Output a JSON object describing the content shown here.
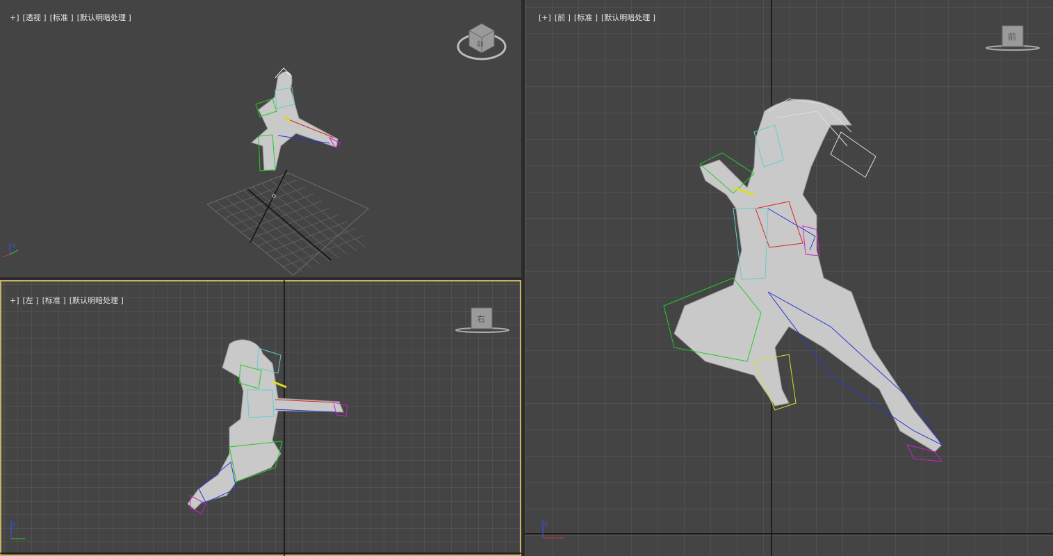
{
  "viewports": {
    "perspective": {
      "menu": "+]",
      "view": "[透视 ]",
      "shading": "[标准 ]",
      "lighting": "[默认明暗处理 ]",
      "cube_face": "前"
    },
    "left": {
      "menu": "+]",
      "view": "[左 ]",
      "shading": "[标准 ]",
      "lighting": "[默认明暗处理 ]",
      "cube_face": "右"
    },
    "front": {
      "menu": "[+]",
      "view": "[前 ]",
      "shading": "[标准 ]",
      "lighting": "[默认明暗处理 ]",
      "cube_face": "前"
    }
  },
  "colors": {
    "viewport_bg": "#444444",
    "grid": "#5a5a5a",
    "grid_axis": "#111111",
    "active_border": "#c8b268",
    "label_text": "#e6e6e6",
    "mesh": "#c9c9c9",
    "bone_green": "#22cc22",
    "bone_blue": "#2233dd",
    "bone_cyan": "#66cccc",
    "bone_red": "#dd2222",
    "bone_yellow": "#dddd22",
    "bone_magenta": "#cc22cc"
  },
  "axis_labels": {
    "x": "x",
    "y": "y",
    "z": "z"
  }
}
